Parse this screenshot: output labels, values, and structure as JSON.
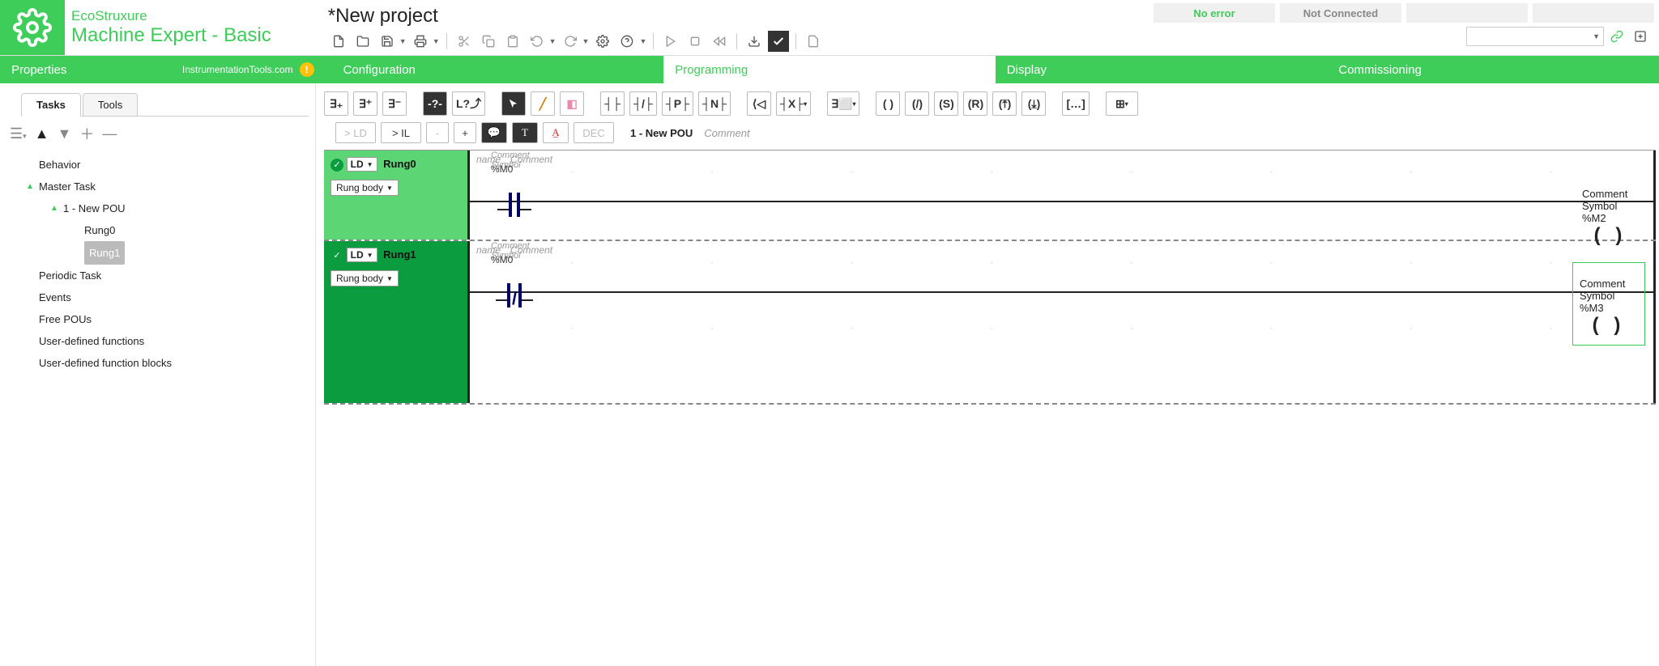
{
  "header": {
    "brand_top": "EcoStruxure",
    "brand_sub": "Machine Expert - Basic",
    "project_title": "*New project",
    "status_error": "No error",
    "status_conn": "Not Connected"
  },
  "nav": {
    "tabs": [
      "Properties",
      "Configuration",
      "Programming",
      "Display",
      "Commissioning"
    ],
    "active": "Programming",
    "watermark": "InstrumentationTools.com"
  },
  "sidebar": {
    "tabs": [
      "Tasks",
      "Tools"
    ],
    "active": "Tasks",
    "tree": {
      "behavior": "Behavior",
      "master": "Master Task",
      "pou": "1 - New POU",
      "rung0": "Rung0",
      "rung1": "Rung1",
      "periodic": "Periodic Task",
      "events": "Events",
      "free": "Free POUs",
      "udf": "User-defined functions",
      "udfb": "User-defined function blocks"
    }
  },
  "editor": {
    "tb2_ld": "> LD",
    "tb2_il": "> IL",
    "tb2_minus": "-",
    "tb2_plus": "+",
    "tb2_dec": "DEC",
    "pou_title": "1 - New POU",
    "pou_comment": "Comment",
    "rung_hdr_name": "name",
    "rung_hdr_comment": "Comment",
    "cell_comment": "Comment",
    "cell_symbol": "Symbol",
    "lang_badge": "LD",
    "body_dd": "Rung body",
    "rungs": [
      {
        "name": "Rung0",
        "active": true,
        "contact_addr": "%M0",
        "contact_type": "NO",
        "coil_addr": "%M2",
        "coil_highlight": false
      },
      {
        "name": "Rung1",
        "active": false,
        "contact_addr": "%M0",
        "contact_type": "NC",
        "coil_addr": "%M3",
        "coil_highlight": true
      }
    ]
  }
}
